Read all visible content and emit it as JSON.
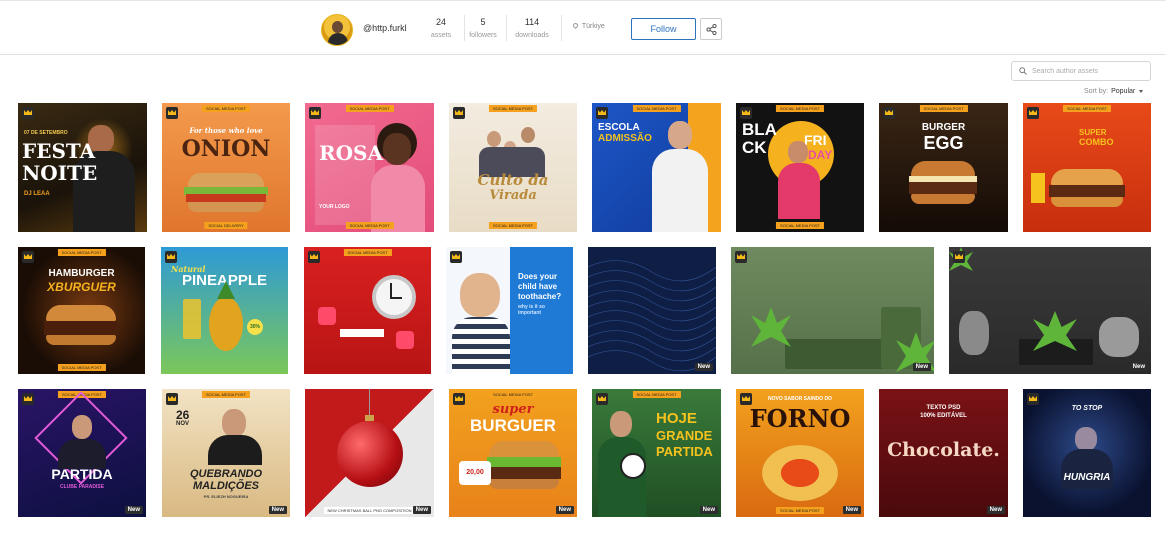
{
  "profile": {
    "username": "@http.furkl",
    "stats": [
      {
        "value": "24",
        "label": "assets"
      },
      {
        "value": "5",
        "label": "followers"
      },
      {
        "value": "114",
        "label": "downloads"
      }
    ],
    "location": "Türkiye",
    "follow_label": "Follow"
  },
  "search": {
    "placeholder": "Search author assets"
  },
  "sort": {
    "label": "Sort by:",
    "value": "Popular"
  },
  "new_label": "New",
  "thumb_text": {
    "t1": {
      "date": "07 DE SETEMBRO",
      "title1": "FESTA",
      "title2": "NOITE",
      "sub": "DJ LEAA"
    },
    "t2": {
      "line1": "For those who love",
      "title": "ONION"
    },
    "t3": {
      "title1": "ROSA",
      "sub": "YOUR LOGO"
    },
    "t4": {
      "title1": "Culto da",
      "title2": "Virada"
    },
    "t5": {
      "title1": "ESCOLA",
      "title2": "ADMISSÃO"
    },
    "t6": {
      "title1": "BLA",
      "title2": "CK",
      "title3": "FRI",
      "title4": "DAY"
    },
    "t7": {
      "title1": "BURGER",
      "title2": "EGG"
    },
    "t8": {
      "title1": "SUPER",
      "title2": "COMBO"
    },
    "t9": {
      "title1": "HAMBURGER",
      "title2": "XBURGUER"
    },
    "t10": {
      "title0": "Natural",
      "title1": "PINEAPPLE",
      "badge": "30%"
    },
    "t12": {
      "title1": "Does your",
      "title2": "child have",
      "title3": "toothache?",
      "sub": "why is it so",
      "sub2": "important"
    },
    "t15": {
      "date": "",
      "title": "PARTIDA",
      "sub": "CLUBE PARADISE"
    },
    "t16": {
      "date1": "26",
      "date2": "NOV",
      "title1": "QUEBRANDO",
      "title2": "MALDIÇÕES",
      "sub": "PR. ELIEZH NOGUEIRA"
    },
    "t18": {
      "title1": "super",
      "title2": "BURGUER",
      "price1": "20,00"
    },
    "t19": {
      "title1": "HOJE",
      "title2": "GRANDE",
      "title3": "PARTIDA"
    },
    "t20": {
      "line1": "NOVO SABOR SAINDO DO",
      "title": "FORNO"
    },
    "t21": {
      "line1": "TEXTO PSD",
      "line2": "100% EDITÁVEL",
      "title": "Chocolate."
    },
    "t22": {
      "line1": "TO STOP",
      "title": "HUNGRIA"
    }
  },
  "colors": {
    "accent": "#2b73bd",
    "tag_orange": "#f6a11e",
    "crown_gold": "#f5b91a"
  }
}
